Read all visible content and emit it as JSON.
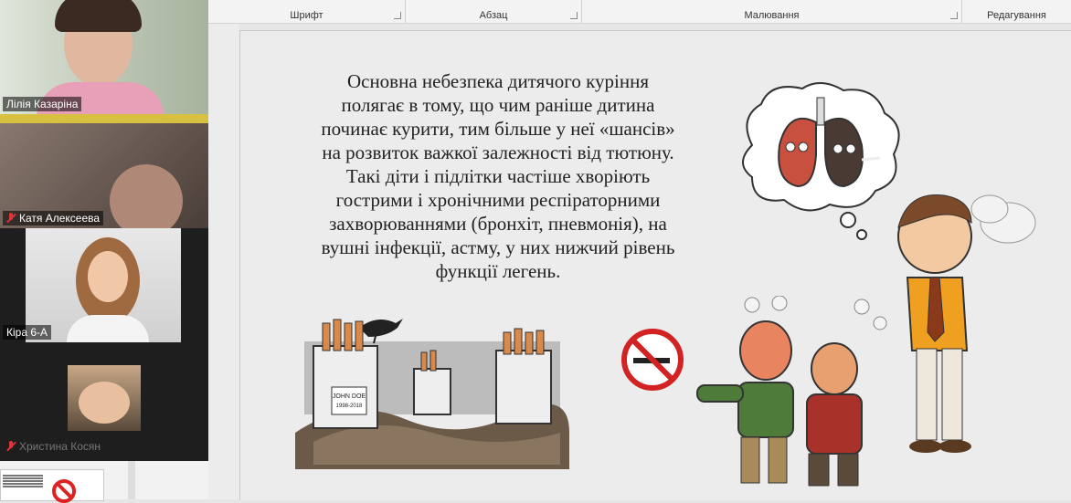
{
  "ribbon": {
    "groups": [
      {
        "label": "Шрифт"
      },
      {
        "label": "Абзац"
      },
      {
        "label": "Малювання"
      },
      {
        "label": "Редагування"
      }
    ]
  },
  "participants": [
    {
      "name": "Лілія Казаріна",
      "muted": false,
      "active": true
    },
    {
      "name": "Катя Алексеева",
      "muted": true,
      "active": false
    },
    {
      "name": "Кіра 6-А",
      "muted": false,
      "active": false
    },
    {
      "name": "Христина Косян",
      "muted": true,
      "active": false
    }
  ],
  "slide": {
    "lines": [
      "Основна небезпека дитячого куріння",
      "полягає в тому, що чим раніше дитина",
      "починає курити, тим більше у неї «шансів»",
      "на розвиток важкої залежності від тютюну.",
      "Такі діти і підлітки частіше хворіють",
      "гострими і хронічними респіраторними",
      "захворюваннями (бронхіт, пневмонія), на",
      "вушні інфекції, астму, у них нижчий рівень",
      "функції легень."
    ],
    "gravestone_texts": [
      "JOHN DOE",
      "1998-2018"
    ]
  },
  "colors": {
    "active_border": "#2fd060",
    "no_smoking_red": "#d22222"
  }
}
